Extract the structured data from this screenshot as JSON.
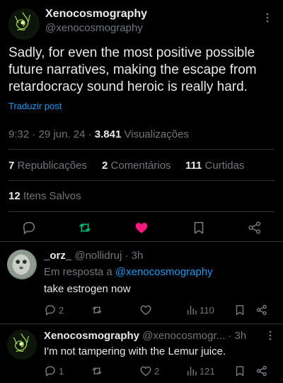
{
  "tweet": {
    "author_name": "Xenocosmography",
    "author_handle": "@xenocosmography",
    "text": "Sadly, for even the most positive possible future narratives, making the escape from retardocracy sound heroic is really hard.",
    "translate_label": "Traduzir post",
    "time": "9:32",
    "date": "29 jun. 24",
    "views_count": "3.841",
    "views_label": "Visualizações",
    "reposts_count": "7",
    "reposts_label": "Republicações",
    "comments_count": "2",
    "comments_label": "Comentários",
    "likes_count": "111",
    "likes_label": "Curtidas",
    "saved_count": "12",
    "saved_label": "Itens Salvos",
    "like_color": "#f91880",
    "repost_color": "#00ba7c"
  },
  "replies": [
    {
      "name": "_orz_",
      "handle": "@nollidruj",
      "time": "3h",
      "replying_prefix": "Em resposta a",
      "replying_to": "@xenocosmography",
      "text": "take estrogen now",
      "reply_count": "2",
      "repost_count": "",
      "like_count": "",
      "views_count": "110"
    },
    {
      "name": "Xenocosmography",
      "handle": "@xenocosmogr...",
      "time": "3h",
      "text": "I'm not tampering with the Lemur juice.",
      "reply_count": "1",
      "repost_count": "",
      "like_count": "2",
      "views_count": "121"
    }
  ],
  "separator_dot": "·"
}
